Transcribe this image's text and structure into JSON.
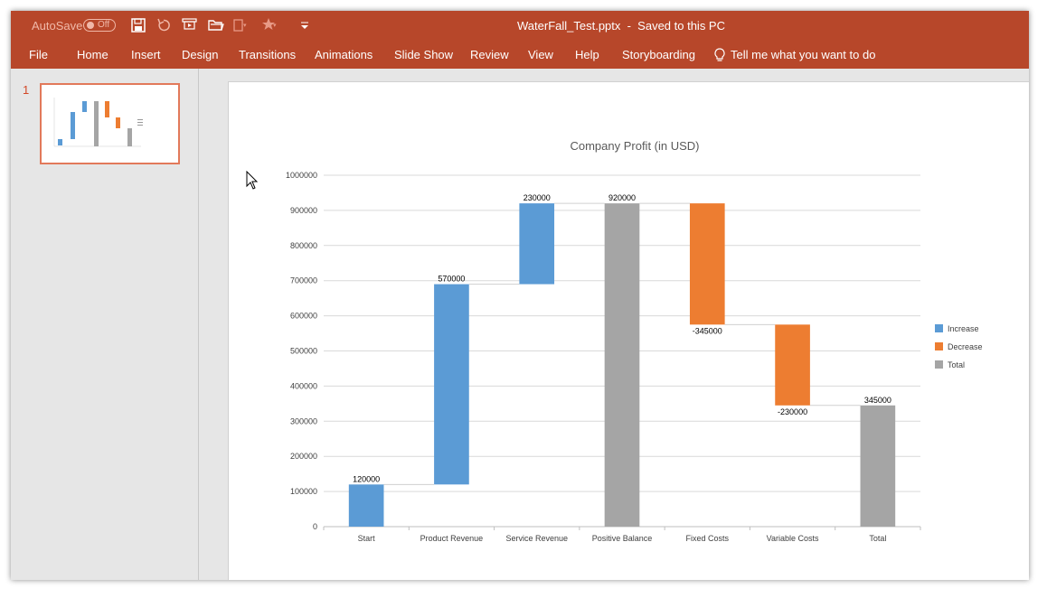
{
  "titlebar": {
    "autosave_label": "AutoSave",
    "autosave_state": "Off",
    "doc_title": "WaterFall_Test.pptx  -  Saved to this PC"
  },
  "menu": {
    "items": [
      "File",
      "Home",
      "Insert",
      "Design",
      "Transitions",
      "Animations",
      "Slide Show",
      "Review",
      "View",
      "Help",
      "Storyboarding"
    ],
    "tell_me": "Tell me what you want to do"
  },
  "thumbnails": {
    "slide_number": "1"
  },
  "colors": {
    "accent": "#b7472a",
    "increase": "#5b9bd5",
    "decrease": "#ed7d31",
    "total": "#a5a5a5"
  },
  "chart_data": {
    "type": "bar",
    "subtype": "waterfall",
    "title": "Company Profit (in USD)",
    "categories": [
      "Start",
      "Product Revenue",
      "Service Revenue",
      "Positive Balance",
      "Fixed Costs",
      "Variable Costs",
      "Total"
    ],
    "values": [
      120000,
      570000,
      230000,
      920000,
      -345000,
      -230000,
      345000
    ],
    "labels": [
      "120000",
      "570000",
      "230000",
      "920000",
      "-345000",
      "-230000",
      "345000"
    ],
    "kinds": [
      "Increase",
      "Increase",
      "Increase",
      "Total",
      "Decrease",
      "Decrease",
      "Total"
    ],
    "ylim": [
      0,
      1000000
    ],
    "yticks": [
      "0",
      "100000",
      "200000",
      "300000",
      "400000",
      "500000",
      "600000",
      "700000",
      "800000",
      "900000",
      "1000000"
    ],
    "grid": true,
    "legend": {
      "position": "right",
      "entries": [
        "Increase",
        "Decrease",
        "Total"
      ]
    }
  }
}
